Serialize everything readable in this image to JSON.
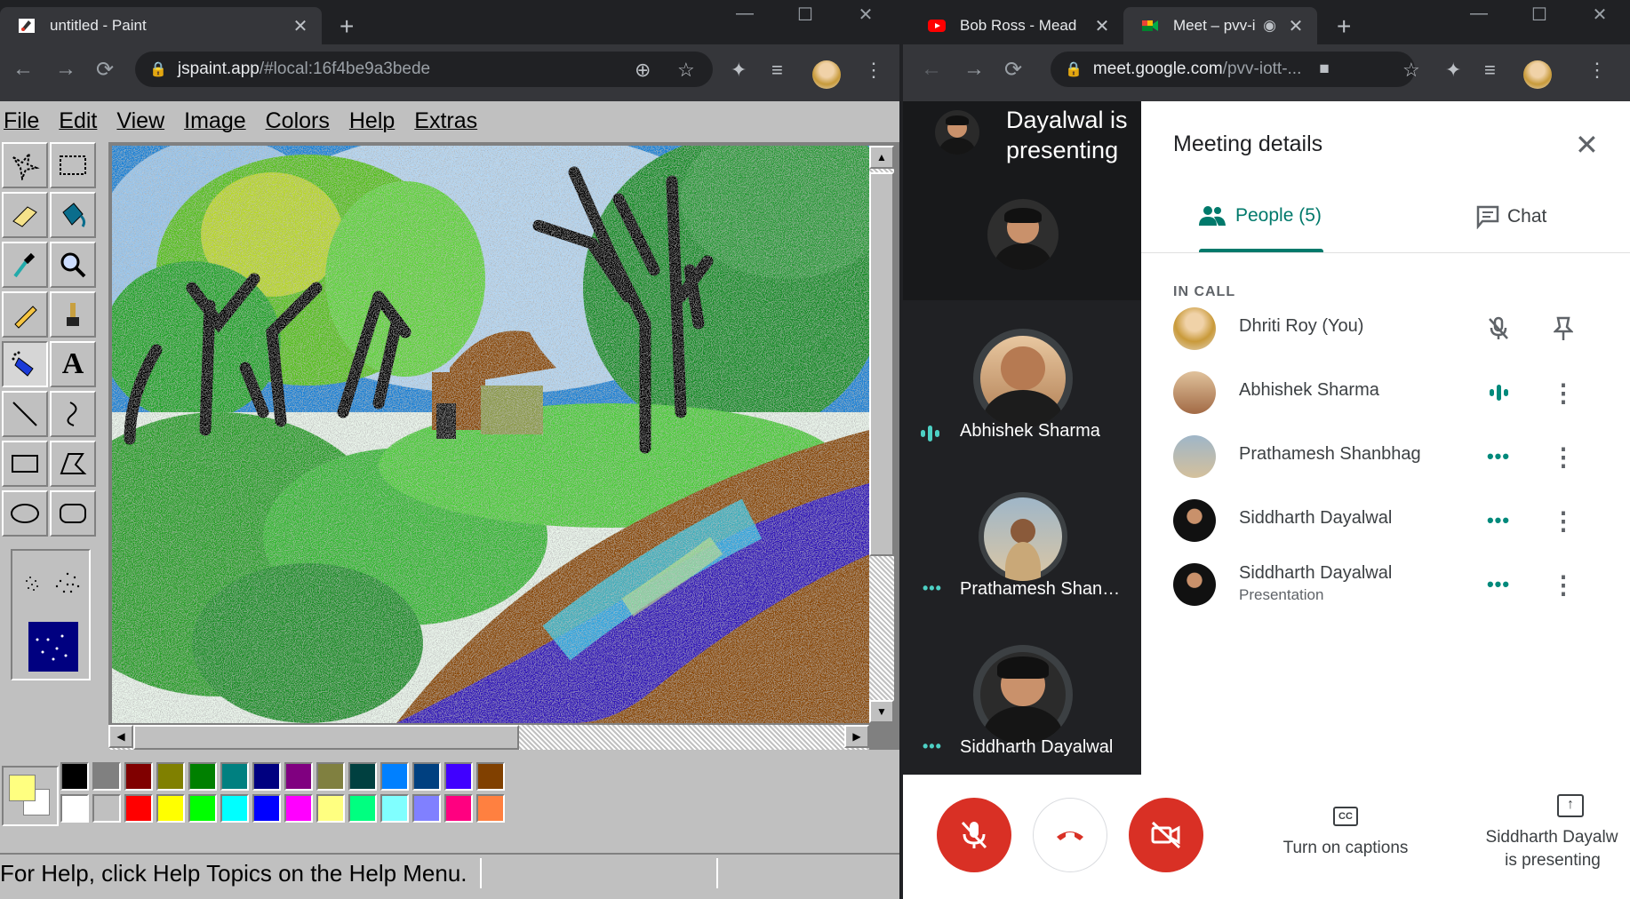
{
  "left_browser": {
    "tab_title": "untitled - Paint",
    "url_main": "jspaint.app",
    "url_rest": "/#local:16f4be9a3bede",
    "menus": [
      "File",
      "Edit",
      "View",
      "Image",
      "Colors",
      "Help",
      "Extras"
    ],
    "status_text": "For Help, click Help Topics on the Help Menu.",
    "palette_top": [
      "#000000",
      "#808080",
      "#800000",
      "#808000",
      "#008000",
      "#008080",
      "#000080",
      "#800080",
      "#808040",
      "#004040",
      "#0080ff",
      "#004080",
      "#4000ff",
      "#804000"
    ],
    "palette_bottom": [
      "#ffffff",
      "#c0c0c0",
      "#ff0000",
      "#ffff00",
      "#00ff00",
      "#00ffff",
      "#0000ff",
      "#ff00ff",
      "#ffff80",
      "#00ff80",
      "#80ffff",
      "#8080ff",
      "#ff0080",
      "#ff8040"
    ],
    "primary_color": "#ffff80",
    "secondary_color": "#ffffff"
  },
  "right_browser": {
    "tab1_title": "Bob Ross - Mead",
    "tab2_title": "Meet – pvv-i",
    "url_main": "meet.google.com",
    "url_rest": "/pvv-iott-..."
  },
  "meet": {
    "presenting_text": "Dayalwal is presenting",
    "tiles": [
      "Abhishek Sharma",
      "Prathamesh Shan…",
      "Siddharth Dayalwal"
    ],
    "panel_title": "Meeting details",
    "tab_people": "People (5)",
    "tab_chat": "Chat",
    "in_call_label": "IN CALL",
    "participants": [
      {
        "name": "Dhriti Roy (You)",
        "sub": ""
      },
      {
        "name": "Abhishek Sharma",
        "sub": ""
      },
      {
        "name": "Prathamesh Shanbhag",
        "sub": ""
      },
      {
        "name": "Siddharth Dayalwal",
        "sub": ""
      },
      {
        "name": "Siddharth Dayalwal",
        "sub": "Presentation"
      }
    ],
    "captions_label": "Turn on captions",
    "presenting_label_1": "Siddharth Dayalw",
    "presenting_label_2": "is presenting"
  }
}
